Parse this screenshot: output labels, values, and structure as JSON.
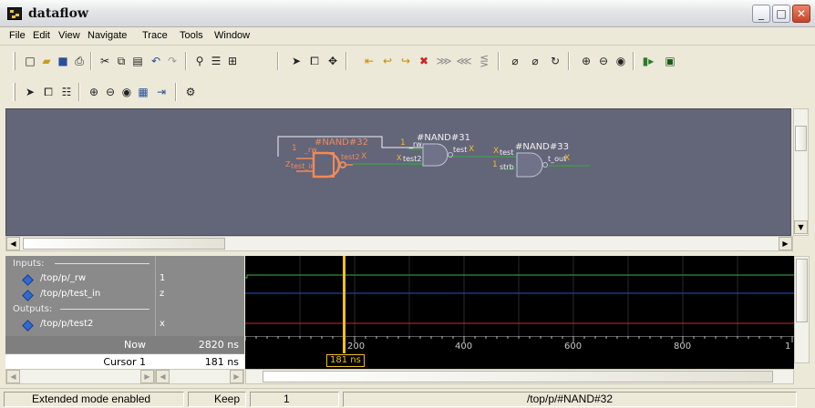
{
  "window": {
    "title": "dataflow",
    "minimize": "_",
    "maximize": "□",
    "close": "✕"
  },
  "menu": [
    "File",
    "Edit",
    "View",
    "Navigate",
    "Trace",
    "Tools",
    "Window"
  ],
  "schematic": {
    "gate32": {
      "name": "#NAND#32",
      "in_top_value": "1",
      "in_top_label": "_rw",
      "in_bottom_value": "Z",
      "in_bottom_label": "test_in",
      "out_label": "test2",
      "out_value": "X"
    },
    "gate31": {
      "name": "#NAND#31",
      "in_top_value": "1",
      "in_top_label": "_rw",
      "in_bottom_value": "X",
      "in_bottom_label": "test2",
      "out_label": "test",
      "out_value": "X"
    },
    "gate33": {
      "name": "#NAND#33",
      "in_top_value": "X",
      "in_top_label": "test",
      "in_bottom_value": "1",
      "in_bottom_label": "strb",
      "out_label": "t_out",
      "out_value": "X"
    }
  },
  "wave": {
    "groups": {
      "inputs": "Inputs:",
      "outputs": "Outputs:"
    },
    "signals": [
      {
        "name": "/top/p/_rw",
        "value": "1"
      },
      {
        "name": "/top/p/test_in",
        "value": "z"
      },
      {
        "name": "/top/p/test2",
        "value": "x"
      }
    ],
    "now_label": "Now",
    "now_value": "2820 ns",
    "cursor_label": "Cursor 1",
    "cursor_value": "181 ns",
    "cursor_flag": "181 ns",
    "ruler_ticks": [
      "200",
      "400",
      "600",
      "800",
      "1"
    ]
  },
  "status": {
    "mode": "Extended mode enabled",
    "keep": "Keep",
    "count": "1",
    "path": "/top/p/#NAND#32"
  },
  "colors": {
    "schematic_bg": "#636579",
    "highlight": "#f08a5a",
    "wire_green": "#3fa04a",
    "cursor": "#f0c020"
  }
}
